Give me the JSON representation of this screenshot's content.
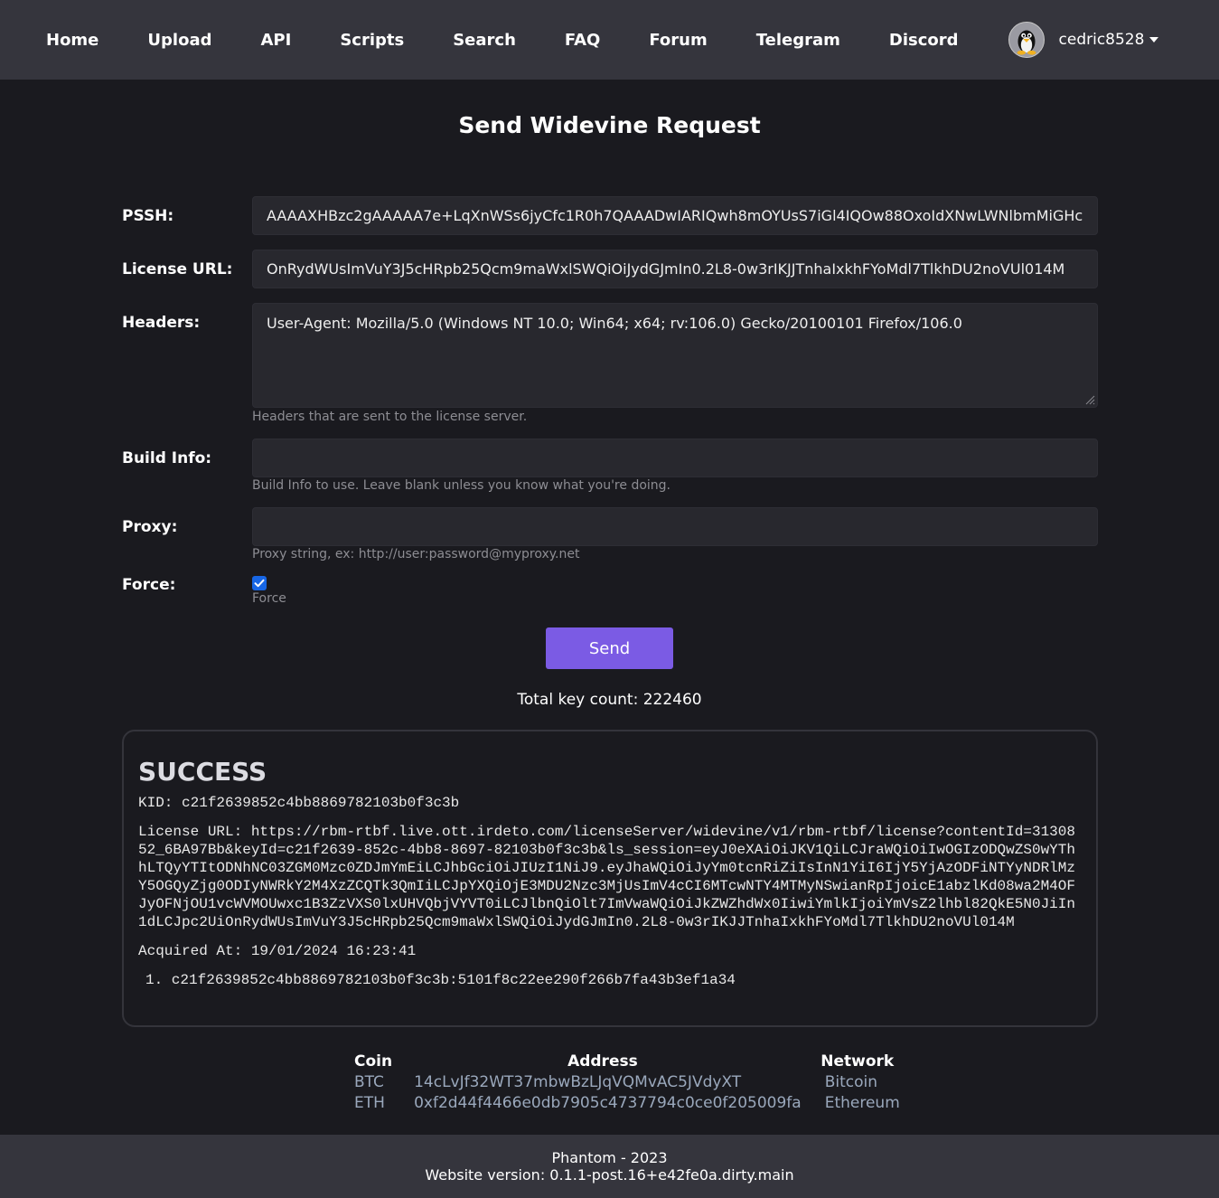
{
  "nav": {
    "items": [
      {
        "label": "Home"
      },
      {
        "label": "Upload"
      },
      {
        "label": "API"
      },
      {
        "label": "Scripts"
      },
      {
        "label": "Search"
      },
      {
        "label": "FAQ"
      },
      {
        "label": "Forum"
      },
      {
        "label": "Telegram"
      },
      {
        "label": "Discord"
      }
    ],
    "username": "cedric8528",
    "avatar_icon": "penguin-icon"
  },
  "page": {
    "title": "Send Widevine Request"
  },
  "form": {
    "pssh_label": "PSSH:",
    "pssh_value": "AAAAXHBzc2gAAAAA7e+LqXnWSs6jyCfc1R0h7QAAADwIARIQwh8mOYUsS7iGl4IQOw88OxoIdXNwLWNlbmMiGHc",
    "license_label": "License URL:",
    "license_value": "OnRydWUsImVuY3J5cHRpb25Qcm9maWxlSWQiOiJydGJmIn0.2L8-0w3rIKJJTnhaIxkhFYoMdl7TlkhDU2noVUl014M",
    "headers_label": "Headers:",
    "headers_value": "User-Agent: Mozilla/5.0 (Windows NT 10.0; Win64; x64; rv:106.0) Gecko/20100101 Firefox/106.0",
    "headers_help": "Headers that are sent to the license server.",
    "build_label": "Build Info:",
    "build_value": "",
    "build_help": "Build Info to use. Leave blank unless you know what you're doing.",
    "proxy_label": "Proxy:",
    "proxy_value": "",
    "proxy_help": "Proxy string, ex: http://user:password@myproxy.net",
    "force_label": "Force:",
    "force_checked": true,
    "force_help": "Force",
    "send_label": "Send"
  },
  "stats": {
    "key_count": "Total key count: 222460"
  },
  "result": {
    "status": "SUCCESS",
    "kid": "KID: c21f2639852c4bb8869782103b0f3c3b",
    "license_url": "License URL: https://rbm-rtbf.live.ott.irdeto.com/licenseServer/widevine/v1/rbm-rtbf/license?contentId=3130852_6BA97Bb&keyId=c21f2639-852c-4bb8-8697-82103b0f3c3b&ls_session=eyJ0eXAiOiJKV1QiLCJraWQiOiIwOGIzODQwZS0wYThhLTQyYTItODNhNC03ZGM0Mzc0ZDJmYmEiLCJhbGciOiJIUzI1NiJ9.eyJhaWQiOiJyYm0tcnRiZiIsInN1YiI6IjY5YjAzODFiNTYyNDRlMzY5OGQyZjg0ODIyNWRkY2M4XzZCQTk3QmIiLCJpYXQiOjE3MDU2Nzc3MjUsImV4cCI6MTcwNTY4MTMyNSwianRpIjoicE1abzlKd08wa2M4OFJyOFNjOU1vcWVMOUwxc1B3ZzVXS0lxUHVQbjVYVT0iLCJlbnQiOlt7ImVwaWQiOiJkZWZhdWx0IiwiYmlkIjoiYmVsZ2lhbl82QkE5N0JiIn1dLCJpc2UiOnRydWUsImVuY3J5cHRpb25Qcm9maWxlSWQiOiJydGJmIn0.2L8-0w3rIKJJTnhaIxkhFYoMdl7TlkhDU2noVUl014M",
    "acquired": "Acquired At: 19/01/2024 16:23:41",
    "keys": [
      "1. c21f2639852c4bb8869782103b0f3c3b:5101f8c22ee290f266b7fa43b3ef1a34"
    ]
  },
  "donations": {
    "headers": [
      "Coin",
      "Address",
      "Network"
    ],
    "rows": [
      [
        "BTC",
        "14cLvJf32WT37mbwBzLJqVQMvAC5JVdyXT",
        "Bitcoin"
      ],
      [
        "ETH",
        "0xf2d44f4466e0db7905c4737794c0ce0f205009fa",
        "Ethereum"
      ]
    ]
  },
  "footer": {
    "line1": "Phantom - 2023",
    "line2": "Website version: 0.1.1-post.16+e42fe0a.dirty.main"
  },
  "colors": {
    "background": "#1a1a1f",
    "navbar": "#35353d",
    "accent": "#7b5be4",
    "checkbox": "#1766e5"
  }
}
